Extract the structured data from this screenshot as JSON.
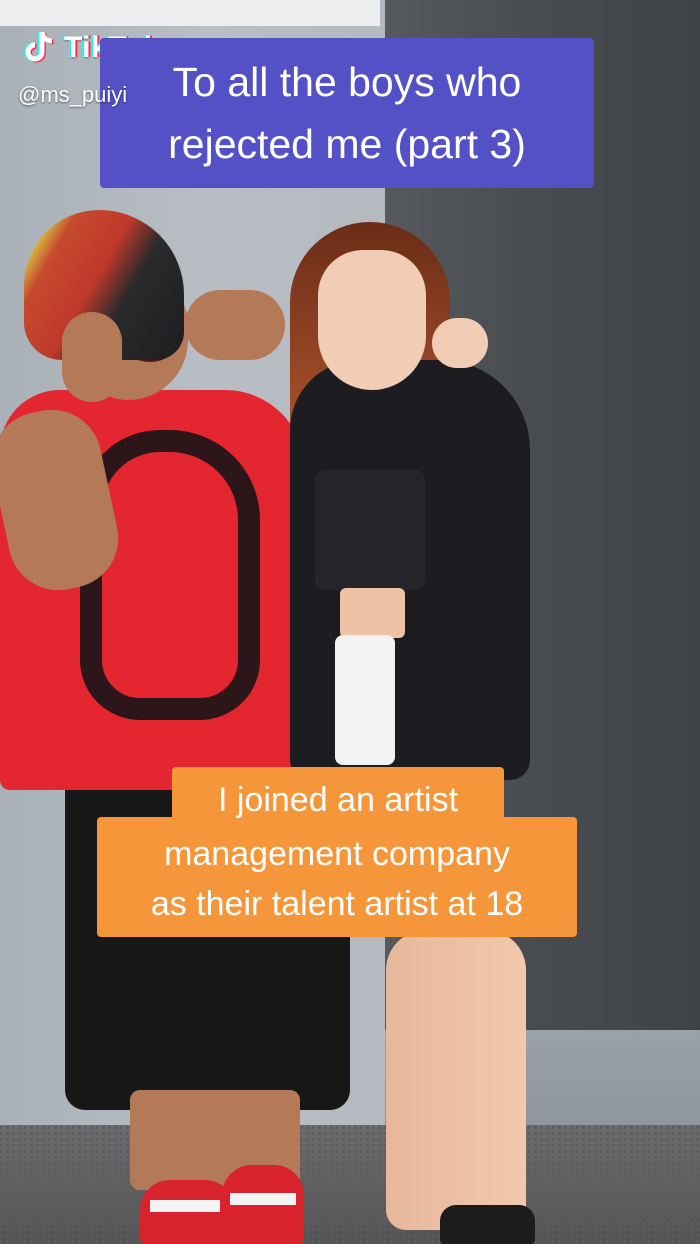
{
  "app": {
    "logo_text": "TikTok",
    "username": "@ms_puiyi"
  },
  "captions": {
    "top": [
      "To all the boys who",
      "rejected me (part 3)"
    ],
    "bottom": [
      "I joined an artist",
      "management company",
      "as their talent artist at 18"
    ]
  },
  "colors": {
    "top_caption_bg": "#5451c7",
    "bottom_caption_bg": "#f6963a",
    "text": "#ffffff"
  },
  "icons": {
    "logo": "tiktok-note-icon"
  }
}
